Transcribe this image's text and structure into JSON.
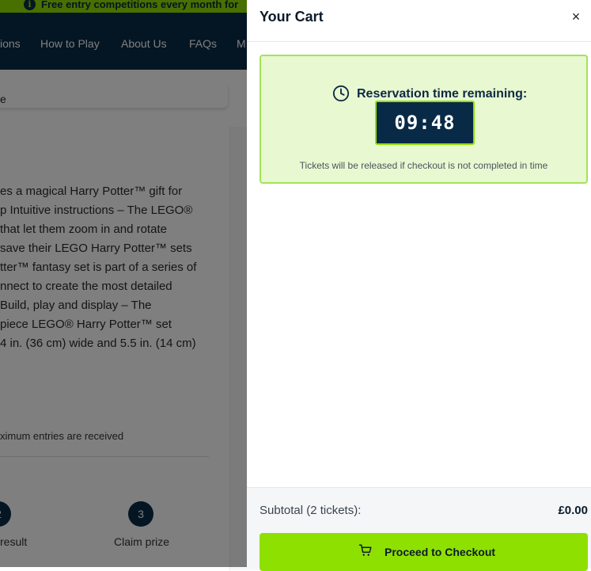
{
  "promo": {
    "text": "Free entry competitions every month for"
  },
  "nav": {
    "items": [
      "ions",
      "How to Play",
      "About Us",
      "FAQs",
      "M"
    ]
  },
  "crumb": {
    "text": "e"
  },
  "description": {
    "lines": [
      "es a magical Harry Potter™ gift for",
      "p Intuitive instructions – The LEGO®",
      " that let them zoom in and rotate",
      " save their LEGO Harry Potter™ sets",
      "tter™ fantasy set is part of a series of",
      "nnect to create the most detailed",
      " Build, play and display – The",
      "piece LEGO® Harry Potter™ set",
      "4 in. (36 cm) wide and 5.5 in. (14 cm)"
    ]
  },
  "entries_note": "ximum entries are received",
  "steps": [
    {
      "num": "2",
      "label": "result"
    },
    {
      "num": "3",
      "label": "Claim prize"
    }
  ],
  "cart": {
    "title": "Your Cart",
    "close_symbol": "×",
    "reservation_label": "Reservation time remaining:",
    "countdown": "09:48",
    "release_note": "Tickets will be released if checkout is not completed in time",
    "subtotal_label": "Subtotal (2 tickets):",
    "subtotal_value": "£0.00",
    "checkout_label": "Proceed to Checkout"
  },
  "colors": {
    "accent_green": "#8ee000",
    "navy": "#082a46",
    "timer_bg": "#e8f8d0"
  }
}
